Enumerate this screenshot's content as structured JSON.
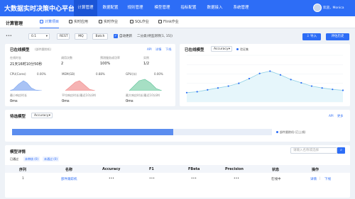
{
  "app": {
    "title": "大数据实时决策中心平台"
  },
  "nav": {
    "items": [
      "计算管理",
      "数据配置",
      "规则管理",
      "模型管理",
      "指标配置",
      "数据接入",
      "系统管理"
    ]
  },
  "user": {
    "greeting": "欢迎，Monica"
  },
  "subnav": {
    "title": "计算管理",
    "tabs": [
      "计算项目",
      "实时应用",
      "实时作业",
      "SQL作业",
      "Flink作业"
    ]
  },
  "toolbar": {
    "more": "•••",
    "select_value": "0.1",
    "btn_rest": "REST",
    "btn_mq": "MQ",
    "btn_batch": "Batch",
    "auto_update": "自动更新",
    "status_text": "二分类(待监测项[1, 15])",
    "import_label": "导入",
    "eval_history_label": "评估历史"
  },
  "online_model": {
    "title": "已在线模型",
    "subtitle": "(部件跟踪机)",
    "links": [
      "API",
      "详情",
      "下线"
    ],
    "fields": [
      {
        "label": "在线时长",
        "value": "21天16时10分50秒"
      },
      {
        "label": "调用次数",
        "value": "2"
      },
      {
        "label": "预测服务成功率",
        "value": "100%"
      },
      {
        "label": "实例",
        "value": "1/2"
      }
    ],
    "metrics": [
      {
        "label": "CPU(Cores)",
        "value": "0.00%"
      },
      {
        "label": "MEM(GB)",
        "value": "0.88%"
      },
      {
        "label": "GPU(卡)",
        "value": "0.00%"
      }
    ],
    "timings": [
      {
        "label": "最小响应时长",
        "value": "0ms"
      },
      {
        "label": "平均响应时长(最近10分钟)",
        "value": "0ms"
      },
      {
        "label": "最大响应时长(最近10分钟)",
        "value": "0ms"
      }
    ]
  },
  "chart_panel": {
    "title": "已在线模型",
    "metric": "Accuracy",
    "legend": "验证集"
  },
  "chart_data": {
    "type": "line",
    "series": [
      {
        "name": "验证集",
        "values": [
          0.2,
          0.22,
          0.26,
          0.3,
          0.34,
          0.4,
          0.5,
          0.61,
          0.66,
          0.58,
          0.48,
          0.41,
          0.34,
          0.3,
          0.27,
          0.25
        ]
      }
    ],
    "ylim": [
      0,
      1
    ],
    "grid": true
  },
  "candidates": {
    "title": "待选模型",
    "metric": "Accuracy",
    "links": [
      "API",
      "更多"
    ],
    "progress": 0.62,
    "legend": "部件跟踪机 (已上线)"
  },
  "details": {
    "title": "模型详情",
    "search_placeholder": "请输入名称或选择",
    "filter_label": "已通过",
    "badges": [
      "未审核 (0)",
      "未通过 (0)"
    ],
    "headers": [
      "序列",
      "名称",
      "Accuracy",
      "F1",
      "FBeta",
      "Precision",
      "状态",
      "操作"
    ],
    "rows": [
      {
        "index": "1",
        "name": "部件跟踪机",
        "accuracy": "•••",
        "f1": "•••",
        "fbeta": "•••",
        "precision": "•••",
        "status": "在线中",
        "action_detail": "详情",
        "action_offline": "下线"
      }
    ]
  },
  "colors": {
    "primary": "#2d6df6",
    "cpu": "#7fa7f0",
    "mem": "#f08a8a",
    "gpu": "#5fc39a"
  }
}
